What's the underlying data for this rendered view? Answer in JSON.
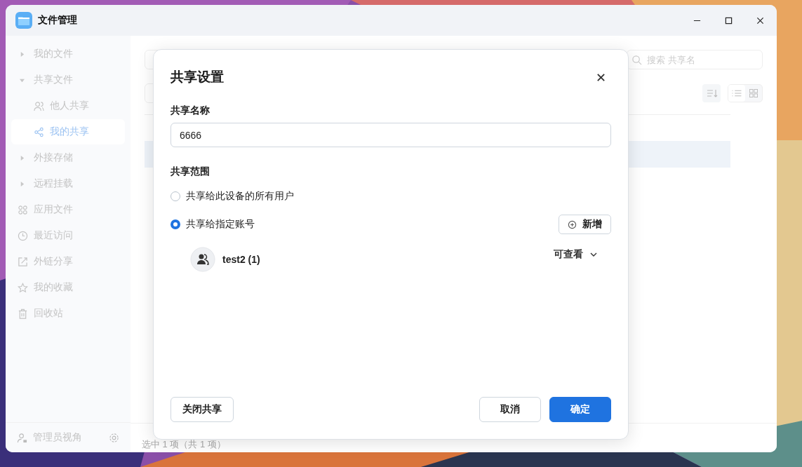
{
  "window": {
    "title": "文件管理"
  },
  "sidebar": {
    "items": [
      {
        "label": "我的文件",
        "kind": "group",
        "expanded": false,
        "selected": false
      },
      {
        "label": "共享文件",
        "kind": "group",
        "expanded": true,
        "selected": false,
        "children": [
          {
            "label": "他人共享",
            "kind": "users",
            "selected": false
          },
          {
            "label": "我的共享",
            "kind": "share",
            "selected": true
          }
        ]
      },
      {
        "label": "外接存储",
        "kind": "group",
        "expanded": false,
        "selected": false
      },
      {
        "label": "远程挂载",
        "kind": "group",
        "expanded": false,
        "selected": false
      },
      {
        "label": "应用文件",
        "kind": "apps",
        "selected": false
      },
      {
        "label": "最近访问",
        "kind": "clock",
        "selected": false
      },
      {
        "label": "外链分享",
        "kind": "link",
        "selected": false
      },
      {
        "label": "我的收藏",
        "kind": "star",
        "selected": false
      },
      {
        "label": "回收站",
        "kind": "trash",
        "selected": false
      }
    ],
    "footer": {
      "label": "管理员视角"
    }
  },
  "search": {
    "placeholder": "搜索 共享名"
  },
  "status_bar": "选中 1 项（共 1 项）",
  "dialog": {
    "title": "共享设置",
    "name_field": {
      "label": "共享名称",
      "value": "6666"
    },
    "scope": {
      "label": "共享范围",
      "options": [
        {
          "label": "共享给此设备的所有用户",
          "selected": false
        },
        {
          "label": "共享给指定账号",
          "selected": true
        }
      ],
      "add_button": "新增"
    },
    "members": [
      {
        "name": "test2 (1)",
        "permission": "可查看"
      }
    ],
    "buttons": {
      "close_share": "关闭共享",
      "cancel": "取消",
      "confirm": "确定"
    }
  }
}
